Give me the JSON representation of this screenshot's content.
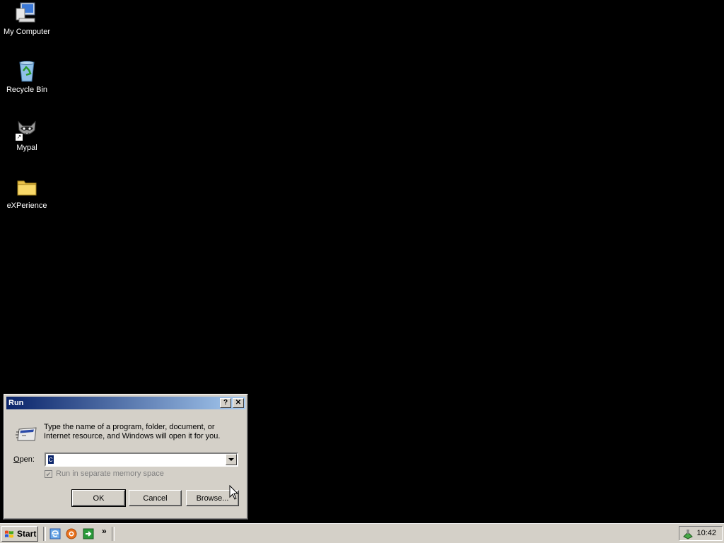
{
  "desktop": {
    "icons": [
      {
        "label": "My Computer",
        "icon": "my-computer-icon"
      },
      {
        "label": "Recycle Bin",
        "icon": "recycle-bin-icon"
      },
      {
        "label": "Mypal",
        "icon": "mypal-raccoon-icon"
      },
      {
        "label": "eXPerience",
        "icon": "folder-icon"
      }
    ]
  },
  "run_dialog": {
    "title": "Run",
    "help_glyph": "?",
    "close_glyph": "✕",
    "description": "Type the name of a program, folder, document, or Internet resource, and Windows will open it for you.",
    "open_label": "Open:",
    "open_value": "c",
    "checkbox_label": "Run in separate memory space",
    "checkbox_checked": true,
    "checkbox_enabled": false,
    "ok_label": "OK",
    "cancel_label": "Cancel",
    "browse_label": "Browse..."
  },
  "taskbar": {
    "start_label": "Start",
    "chevron": "»",
    "clock": "10:42"
  },
  "colors": {
    "desktop": "#000000",
    "title_start": "#0a246a",
    "title_end": "#a6caf0",
    "face": "#d4d0c8"
  }
}
